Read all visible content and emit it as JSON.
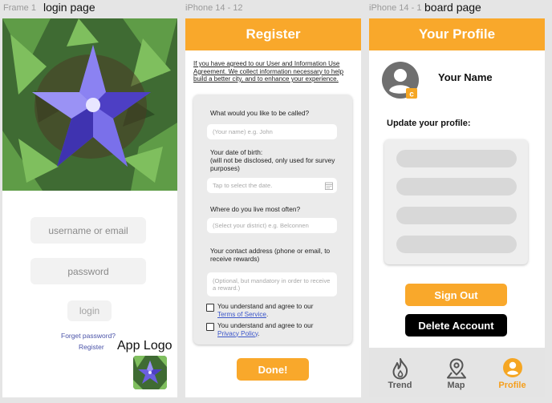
{
  "frames": {
    "login": {
      "label": "Frame 1",
      "title": "login page"
    },
    "register": {
      "label": "iPhone 14 - 12"
    },
    "profile": {
      "label": "iPhone 14 - 1",
      "title": "board page"
    }
  },
  "login": {
    "username_placeholder": "username or email",
    "password_placeholder": "password",
    "login_button": "login",
    "forget_password": "Forget password?",
    "register_link": "Register",
    "app_logo_label": "App Logo"
  },
  "register": {
    "header": "Register",
    "agreement": "If you have agreed to our User and Information Use Agreement. We collect information necessary to help build a better city, and to enhance your experience.",
    "questions": {
      "name": "What would you like to be called?",
      "name_placeholder": "(Your name) e.g. John",
      "dob": "Your date of birth:",
      "dob_note": "(will not be disclosed, only used for survey purposes)",
      "dob_placeholder": "Tap to select the date.",
      "location": "Where do you live most often?",
      "location_placeholder": "(Select your district) e.g. Belconnen",
      "contact": "Your contact address (phone or email, to receive rewards)",
      "contact_placeholder": "(Optional, but mandatory in order to receive a reward.)"
    },
    "agree_text": "You understand and agree to our",
    "terms_link": "Terms of Service",
    "privacy_link": "Privacy Policy",
    "period": ".",
    "done_button": "Done!"
  },
  "profile": {
    "header": "Your Profile",
    "name": "Your Name",
    "update_label": "Update your profile:",
    "sign_out": "Sign Out",
    "delete_account": "Delete Account",
    "tabs": [
      {
        "label": "Trend",
        "icon": "flame-icon"
      },
      {
        "label": "Map",
        "icon": "map-pin-icon"
      },
      {
        "label": "Profile",
        "icon": "user-circle-icon",
        "active": true
      }
    ]
  },
  "colors": {
    "accent": "#f9a82b",
    "link": "#3b55c9",
    "tab_active": "#f59e1c"
  }
}
